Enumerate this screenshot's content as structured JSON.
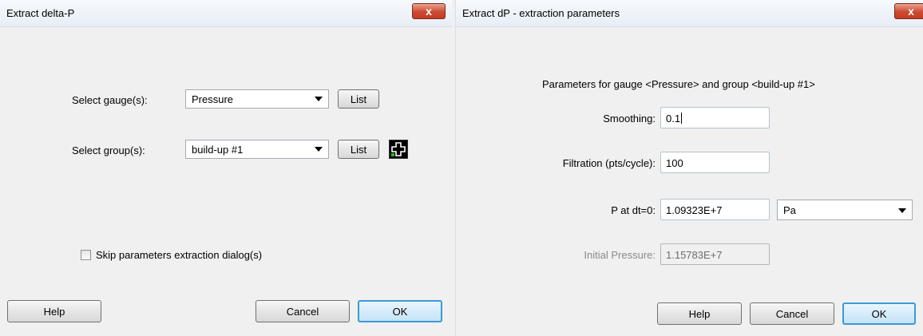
{
  "left_dialog": {
    "title": "Extract delta-P",
    "close_label": "x",
    "gauge_label": "Select gauge(s):",
    "gauge_value": "Pressure",
    "gauge_list_button": "List",
    "group_label": "Select group(s):",
    "group_value": "build-up #1",
    "group_list_button": "List",
    "skip_label": "Skip parameters extraction dialog(s)",
    "skip_checked": false,
    "help_button": "Help",
    "cancel_button": "Cancel",
    "ok_button": "OK"
  },
  "right_dialog": {
    "title": "Extract dP - extraction parameters",
    "close_label": "x",
    "header": "Parameters for gauge <Pressure> and group <build-up #1>",
    "smoothing_label": "Smoothing:",
    "smoothing_value": "0.1",
    "filtration_label": "Filtration (pts/cycle):",
    "filtration_value": "100",
    "p_dt0_label": "P at dt=0:",
    "p_dt0_value": "1.09323E+7",
    "unit_value": "Pa",
    "initial_pressure_label": "Initial Pressure:",
    "initial_pressure_value": "1.15783E+7",
    "help_button": "Help",
    "cancel_button": "Cancel",
    "ok_button": "OK"
  }
}
